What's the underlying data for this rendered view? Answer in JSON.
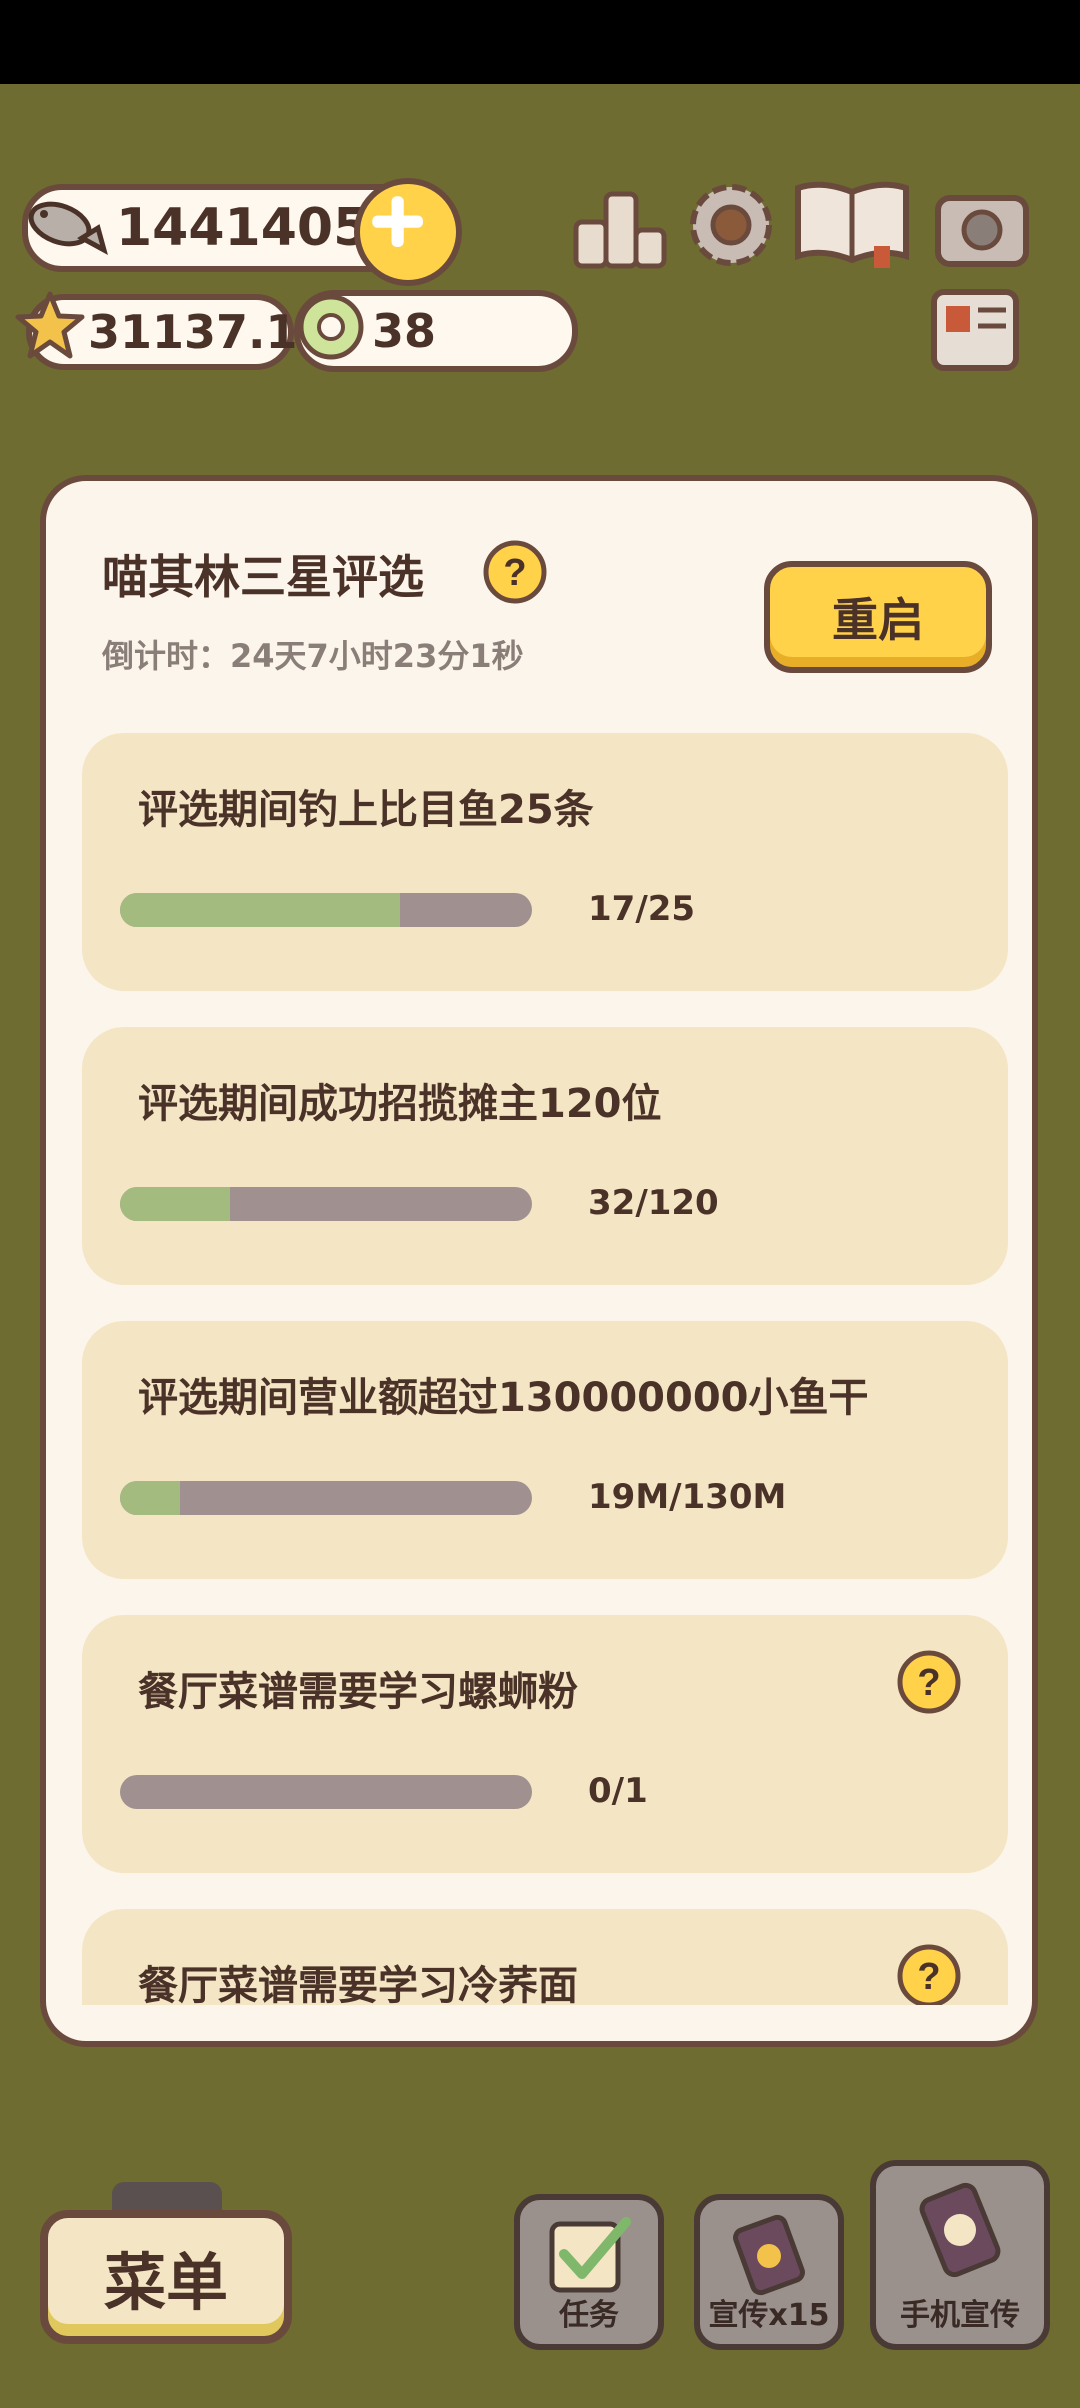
{
  "hud": {
    "fish_coins": "14414057",
    "stars": "31137.1",
    "rings": "38"
  },
  "modal": {
    "title": "喵其林三星评选",
    "countdown": "倒计时：24天7小时23分1秒",
    "restart_label": "重启",
    "tasks": [
      {
        "label": "评选期间钓上比目鱼25条",
        "progress_text": "17/25",
        "progress": 0.68
      },
      {
        "label": "评选期间成功招揽摊主120位",
        "progress_text": "32/120",
        "progress": 0.267
      },
      {
        "label": "评选期间营业额超过130000000小鱼干",
        "progress_text": "19M/130M",
        "progress": 0.146
      },
      {
        "label": "餐厅菜谱需要学习螺蛳粉",
        "progress_text": "0/1",
        "progress": 0
      },
      {
        "label": "餐厅菜谱需要学习冷荞面",
        "progress_text": "",
        "progress": 0
      }
    ]
  },
  "bottom": {
    "menu_label": "菜单",
    "task_label": "任务",
    "promo_label": "宣传x15",
    "phone_promo_label": "手机宣传"
  },
  "colors": {
    "accent_yellow": "#ffd24a",
    "outline_brown": "#6b4a3e",
    "card_bg": "#f4e6c4",
    "progress_green": "#a4bb80",
    "progress_track": "#a09090"
  }
}
